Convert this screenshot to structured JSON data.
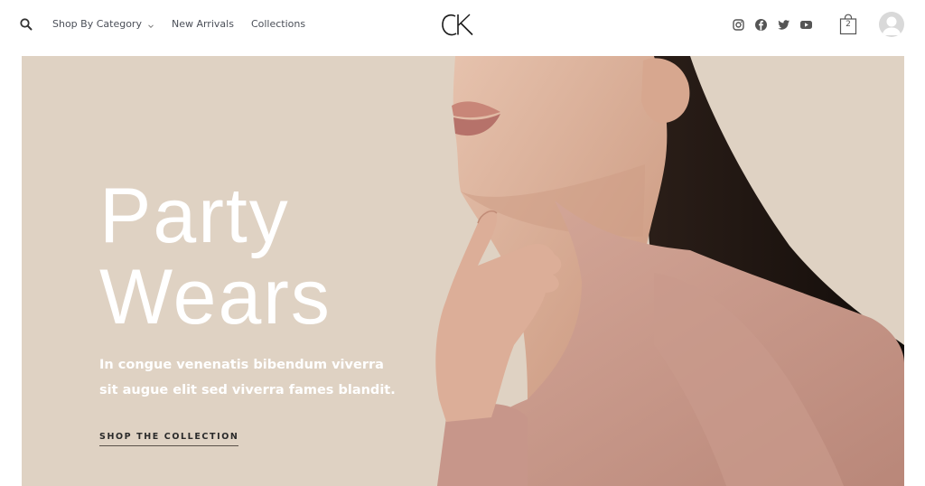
{
  "header": {
    "nav": [
      {
        "label": "Shop By Category",
        "has_dropdown": true
      },
      {
        "label": "New Arrivals",
        "has_dropdown": false
      },
      {
        "label": "Collections",
        "has_dropdown": false
      }
    ],
    "logo_text": "CK",
    "socials": [
      "instagram-icon",
      "facebook-icon",
      "twitter-icon",
      "youtube-icon"
    ],
    "cart_count": "2"
  },
  "hero": {
    "title_line1": "Party",
    "title_line2": "Wears",
    "subtitle": "In congue venenatis bibendum viverra sit augue elit sed viverra fames blandit.",
    "cta": "SHOP THE COLLECTION"
  },
  "colors": {
    "hero_bg": "#dfd2c3",
    "text": "#4b4f58",
    "accent_dark": "#2a2a2a"
  }
}
